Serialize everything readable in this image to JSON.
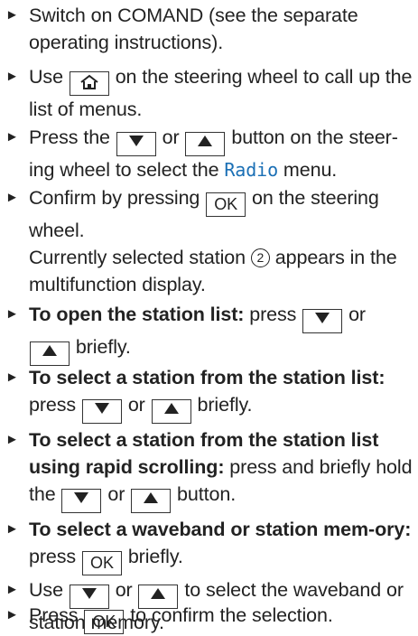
{
  "symbols": {
    "bullet": "►",
    "home_icon": "home-icon",
    "down_icon": "arrow-down-icon",
    "up_icon": "arrow-up-icon"
  },
  "buttons": {
    "ok": "OK"
  },
  "steps": [
    {
      "text": "Switch on COMAND (see the separate operating instructions)."
    },
    {
      "pre": "Use",
      "post": "on the steering wheel to call up the list of menus."
    },
    {
      "pre": "Press the",
      "mid": "or",
      "post1": "button on the steer-ing wheel to select the",
      "menu": "Radio",
      "post2": "menu."
    },
    {
      "pre": "Confirm by pressing",
      "post": "on the steering wheel.",
      "note_pre": "Currently selected station",
      "callout": "2",
      "note_post": "appears in the multifunction display."
    },
    {
      "bold": "To open the station list:",
      "pre": "press",
      "mid": "or",
      "post": "briefly."
    },
    {
      "bold": "To select a station from the station list:",
      "pre": "press",
      "mid": "or",
      "post": "briefly."
    },
    {
      "bold": "To select a station from the station list using rapid scrolling:",
      "pre": "press and briefly hold the",
      "mid": "or",
      "post": "button."
    },
    {
      "bold": "To select a waveband or station mem-ory:",
      "pre": "press",
      "post": "briefly."
    },
    {
      "pre": "Use",
      "mid": "or",
      "post": "to select the waveband or station memory."
    },
    {
      "pre": "Press",
      "post": "to confirm the selection."
    }
  ]
}
